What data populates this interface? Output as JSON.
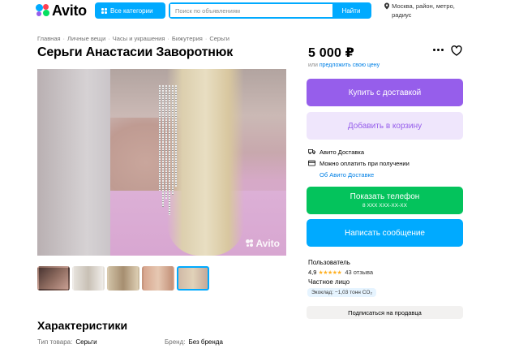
{
  "header": {
    "logo_text": "Avito",
    "categories_label": "Все категории",
    "search_placeholder": "Поиск по объявлениям",
    "search_button": "Найти",
    "location": "Москва, район, метро, радиус"
  },
  "breadcrumb": [
    "Главная",
    "Личные вещи",
    "Часы и украшения",
    "Бижутерия",
    "Серьги"
  ],
  "title": "Серьги Анастасии Заворотнюк",
  "gallery": {
    "watermark": "Avito",
    "thumbnail_count": 5,
    "active_index": 4
  },
  "characteristics": {
    "title": "Характеристики",
    "rows": [
      {
        "key": "Тип товара:",
        "value": "Серьги"
      },
      {
        "key": "Бренд:",
        "value": "Без бренда"
      }
    ]
  },
  "pricing": {
    "price": "5 000 ₽",
    "note_prefix": "или",
    "note_link": "предложить свою цену"
  },
  "actions": {
    "buy_delivery": "Купить с доставкой",
    "add_cart": "Добавить в корзину",
    "show_phone": "Показать телефон",
    "phone_mask": "8 XXX XXX-XX-XX",
    "write_message": "Написать сообщение",
    "subscribe": "Подписаться на продавца"
  },
  "delivery": {
    "line1": "Авито Доставка",
    "line2": "Можно оплатить при получении",
    "link": "Об Авито Доставке"
  },
  "seller": {
    "name": "Пользователь",
    "rating": "4,9",
    "stars": "★★★★★",
    "reviews": "43 отзыва",
    "type": "Частное лицо",
    "eco": "Экоклад: −1,03 тонн CO₂"
  },
  "colors": {
    "avito_blue": "#00aaff",
    "purple": "#965eeb",
    "green": "#04c35c"
  }
}
